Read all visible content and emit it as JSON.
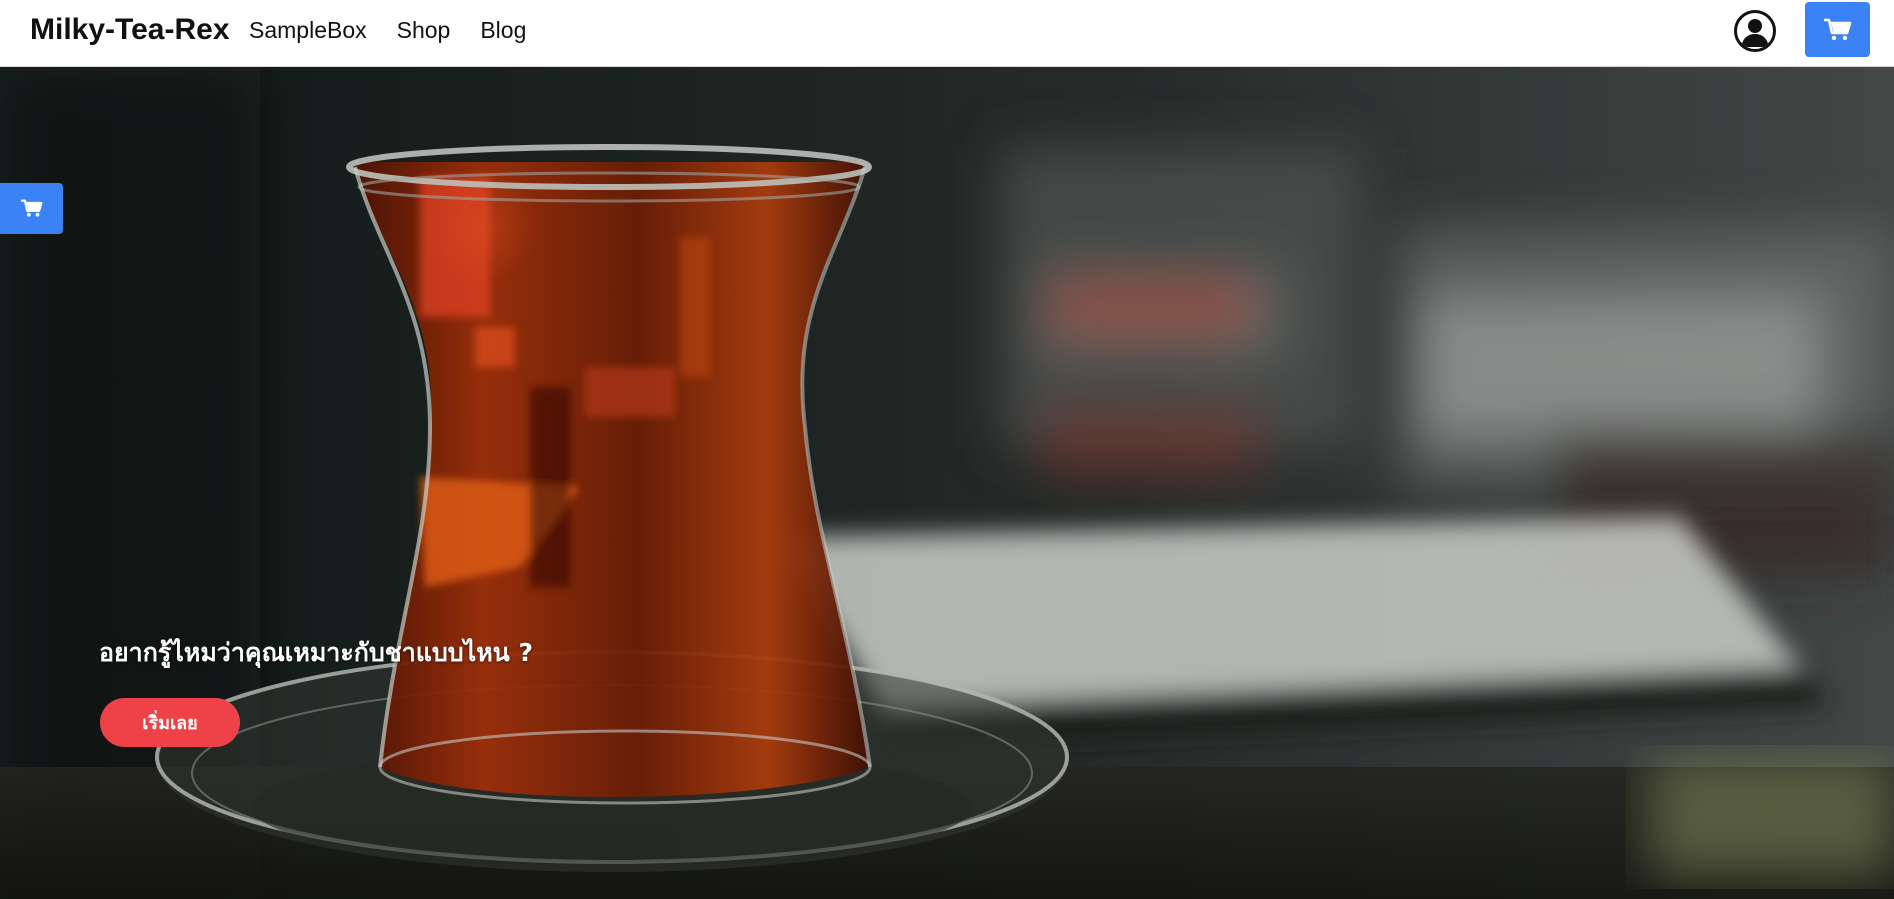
{
  "brand": "Milky-Tea-Rex",
  "nav": {
    "links": [
      "SampleBox",
      "Shop",
      "Blog"
    ]
  },
  "icons": {
    "account": "user-circle-icon",
    "cart": "shopping-cart-icon"
  },
  "colors": {
    "accent_blue": "#3b82f6",
    "cta_red": "#ef4148",
    "navbar_bg": "#ffffff"
  },
  "hero": {
    "heading": "อยากรู้ไหมว่าคุณเหมาะกับชาแบบไหน ?",
    "cta_label": "เริ่มเลย"
  }
}
